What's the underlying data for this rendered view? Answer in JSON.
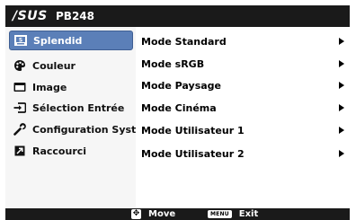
{
  "header": {
    "brand": "/SUS",
    "model": "PB248"
  },
  "sidebar": {
    "items": [
      {
        "label": "Splendid",
        "icon": "splendid-icon",
        "selected": true
      },
      {
        "label": "Couleur",
        "icon": "palette-icon",
        "selected": false
      },
      {
        "label": "Image",
        "icon": "image-icon",
        "selected": false
      },
      {
        "label": "Sélection Entrée",
        "icon": "input-select-icon",
        "selected": false
      },
      {
        "label": "Configuration Système",
        "icon": "wrench-icon",
        "selected": false
      },
      {
        "label": "Raccourci",
        "icon": "shortcut-icon",
        "selected": false
      }
    ]
  },
  "main": {
    "modes": [
      {
        "label": "Mode Standard"
      },
      {
        "label": "Mode sRGB"
      },
      {
        "label": "Mode Paysage"
      },
      {
        "label": "Mode Cinéma"
      },
      {
        "label": "Mode Utilisateur 1"
      },
      {
        "label": "Mode Utilisateur 2"
      }
    ]
  },
  "footer": {
    "move_key": "✥",
    "move_label": "Move",
    "menu_key": "MENU",
    "exit_label": "Exit"
  },
  "colors": {
    "selection": "#5b7fb8",
    "bar": "#1a1a1a"
  }
}
